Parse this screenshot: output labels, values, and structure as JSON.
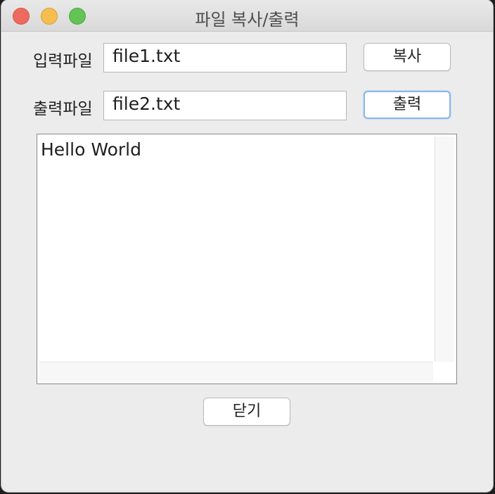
{
  "window": {
    "title": "파일 복사/출력"
  },
  "form": {
    "input_label": "입력파일",
    "input_value": "file1.txt",
    "copy_button": "복사",
    "output_label": "출력파일",
    "output_value": "file2.txt",
    "print_button": "출력"
  },
  "content": {
    "text": "Hello World"
  },
  "footer": {
    "close_button": "닫기"
  },
  "colors": {
    "close": "#ee6a5e",
    "minimize": "#f5be4f",
    "maximize": "#61c454",
    "focus_ring": "#8bb6ea"
  }
}
